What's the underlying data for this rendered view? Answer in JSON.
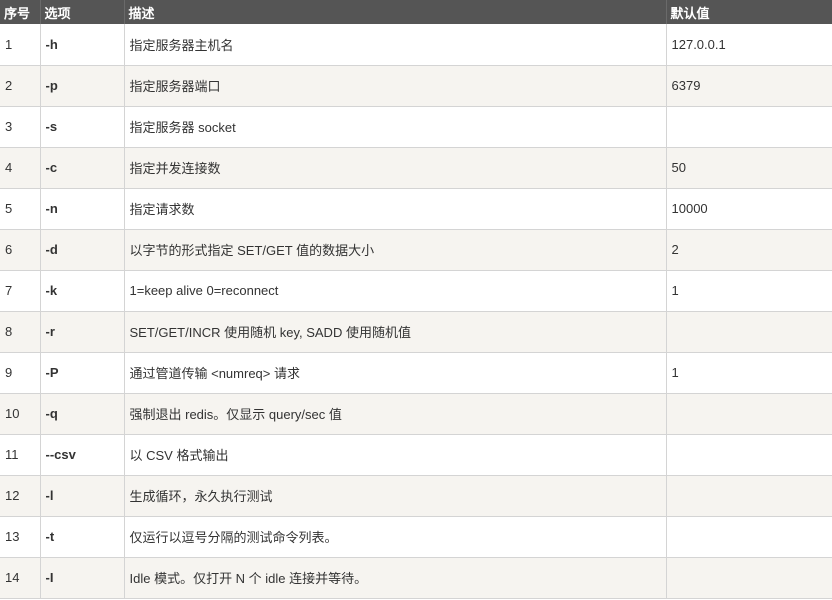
{
  "table": {
    "headers": {
      "index": "序号",
      "option": "选项",
      "description": "描述",
      "default": "默认值"
    },
    "rows": [
      {
        "index": "1",
        "option": "-h",
        "description": "指定服务器主机名",
        "default": "127.0.0.1"
      },
      {
        "index": "2",
        "option": "-p",
        "description": "指定服务器端口",
        "default": "6379"
      },
      {
        "index": "3",
        "option": "-s",
        "description": "指定服务器 socket",
        "default": ""
      },
      {
        "index": "4",
        "option": "-c",
        "description": "指定并发连接数",
        "default": "50"
      },
      {
        "index": "5",
        "option": "-n",
        "description": "指定请求数",
        "default": "10000"
      },
      {
        "index": "6",
        "option": "-d",
        "description": "以字节的形式指定 SET/GET 值的数据大小",
        "default": "2"
      },
      {
        "index": "7",
        "option": "-k",
        "description": "1=keep alive 0=reconnect",
        "default": "1"
      },
      {
        "index": "8",
        "option": "-r",
        "description": "SET/GET/INCR 使用随机 key, SADD 使用随机值",
        "default": ""
      },
      {
        "index": "9",
        "option": "-P",
        "description": "通过管道传输 <numreq> 请求",
        "default": "1"
      },
      {
        "index": "10",
        "option": "-q",
        "description": "强制退出 redis。仅显示 query/sec 值",
        "default": ""
      },
      {
        "index": "11",
        "option": "--csv",
        "description": "以 CSV 格式输出",
        "default": ""
      },
      {
        "index": "12",
        "option": "-l",
        "description": "生成循环，永久执行测试",
        "default": ""
      },
      {
        "index": "13",
        "option": "-t",
        "description": "仅运行以逗号分隔的测试命令列表。",
        "default": ""
      },
      {
        "index": "14",
        "option": "-I",
        "description": "Idle 模式。仅打开 N 个 idle 连接并等待。",
        "default": ""
      }
    ]
  }
}
